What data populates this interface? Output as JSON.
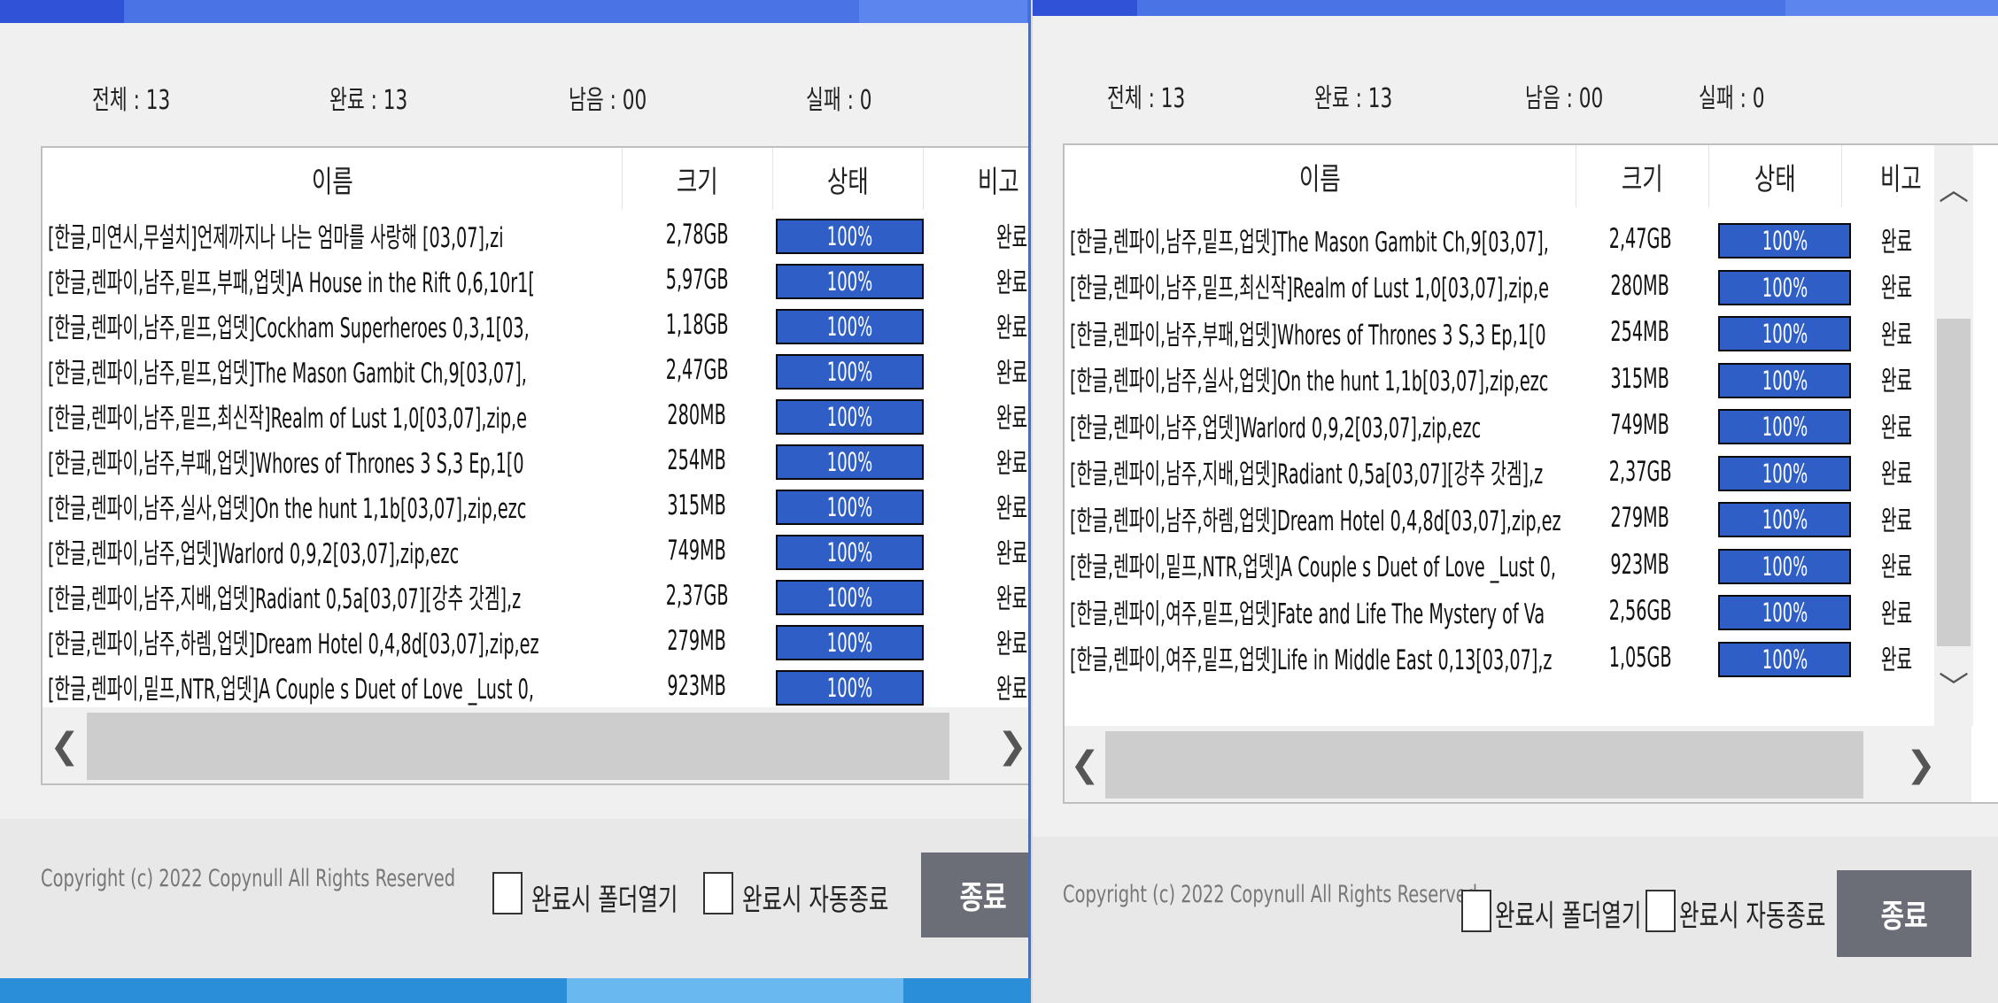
{
  "colors": {
    "titlebar": "#4a74e6",
    "progress": "#2f5fc6",
    "button": "#6b6e76"
  },
  "left": {
    "stats": {
      "total": "전체 : 13",
      "done": "완료 : 13",
      "remaining": "남음 : 00",
      "failed": "실패 : 0"
    },
    "columns": {
      "name": "이름",
      "size": "크기",
      "status": "상태",
      "note": "비고"
    },
    "rows": [
      {
        "name": "[한글,미연시,무설치]언제까지나 나는 엄마를 사랑해 [03,07],zi",
        "size": "2,78GB",
        "progress": 100,
        "progress_label": "100%",
        "note": "완료"
      },
      {
        "name": "[한글,렌파이,남주,밑프,부패,업뎃]A House in the Rift 0,6,10r1[",
        "size": "5,97GB",
        "progress": 100,
        "progress_label": "100%",
        "note": "완료"
      },
      {
        "name": "[한글,렌파이,남주,밑프,업뎃]Cockham Superheroes 0,3,1[03,",
        "size": "1,18GB",
        "progress": 100,
        "progress_label": "100%",
        "note": "완료"
      },
      {
        "name": "[한글,렌파이,남주,밑프,업뎃]The Mason Gambit Ch,9[03,07],",
        "size": "2,47GB",
        "progress": 100,
        "progress_label": "100%",
        "note": "완료"
      },
      {
        "name": "[한글,렌파이,남주,밑프,최신작]Realm of Lust 1,0[03,07],zip,e",
        "size": "280MB",
        "progress": 100,
        "progress_label": "100%",
        "note": "완료"
      },
      {
        "name": "[한글,렌파이,남주,부패,업뎃]Whores of Thrones 3 S,3 Ep,1[0",
        "size": "254MB",
        "progress": 100,
        "progress_label": "100%",
        "note": "완료"
      },
      {
        "name": "[한글,렌파이,남주,실사,업뎃]On the hunt 1,1b[03,07],zip,ezc",
        "size": "315MB",
        "progress": 100,
        "progress_label": "100%",
        "note": "완료"
      },
      {
        "name": "[한글,렌파이,남주,업뎃]Warlord 0,9,2[03,07],zip,ezc",
        "size": "749MB",
        "progress": 100,
        "progress_label": "100%",
        "note": "완료"
      },
      {
        "name": "[한글,렌파이,남주,지배,업뎃]Radiant 0,5a[03,07][강추 갓겜],z",
        "size": "2,37GB",
        "progress": 100,
        "progress_label": "100%",
        "note": "완료"
      },
      {
        "name": "[한글,렌파이,남주,하렘,업뎃]Dream Hotel 0,4,8d[03,07],zip,ez",
        "size": "279MB",
        "progress": 100,
        "progress_label": "100%",
        "note": "완료"
      },
      {
        "name": "[한글,렌파이,밑프,NTR,업뎃]A Couple s Duet of Love _Lust 0,",
        "size": "923MB",
        "progress": 100,
        "progress_label": "100%",
        "note": "완료"
      }
    ],
    "scroll": {
      "left": "❮",
      "right": "❯"
    },
    "footer": {
      "copyright": "Copyright (c) 2022 Copynull All Rights Reserved",
      "open_folder": "완료시 폴더열기",
      "auto_exit": "완료시 자동종료",
      "exit": "종료"
    }
  },
  "right": {
    "stats": {
      "total": "전체 : 13",
      "done": "완료 : 13",
      "remaining": "남음 : 00",
      "failed": "실패 : 0"
    },
    "columns": {
      "name": "이름",
      "size": "크기",
      "status": "상태",
      "note": "비고"
    },
    "rows": [
      {
        "name": "[한글,렌파이,남주,밑프,업뎃]The Mason Gambit Ch,9[03,07],",
        "size": "2,47GB",
        "progress": 100,
        "progress_label": "100%",
        "note": "완료"
      },
      {
        "name": "[한글,렌파이,남주,밑프,최신작]Realm of Lust 1,0[03,07],zip,e",
        "size": "280MB",
        "progress": 100,
        "progress_label": "100%",
        "note": "완료"
      },
      {
        "name": "[한글,렌파이,남주,부패,업뎃]Whores of Thrones 3 S,3 Ep,1[0",
        "size": "254MB",
        "progress": 100,
        "progress_label": "100%",
        "note": "완료"
      },
      {
        "name": "[한글,렌파이,남주,실사,업뎃]On the hunt 1,1b[03,07],zip,ezc",
        "size": "315MB",
        "progress": 100,
        "progress_label": "100%",
        "note": "완료"
      },
      {
        "name": "[한글,렌파이,남주,업뎃]Warlord 0,9,2[03,07],zip,ezc",
        "size": "749MB",
        "progress": 100,
        "progress_label": "100%",
        "note": "완료"
      },
      {
        "name": "[한글,렌파이,남주,지배,업뎃]Radiant 0,5a[03,07][강추 갓겜],z",
        "size": "2,37GB",
        "progress": 100,
        "progress_label": "100%",
        "note": "완료"
      },
      {
        "name": "[한글,렌파이,남주,하렘,업뎃]Dream Hotel 0,4,8d[03,07],zip,ez",
        "size": "279MB",
        "progress": 100,
        "progress_label": "100%",
        "note": "완료"
      },
      {
        "name": "[한글,렌파이,밑프,NTR,업뎃]A Couple s Duet of Love _Lust 0,",
        "size": "923MB",
        "progress": 100,
        "progress_label": "100%",
        "note": "완료"
      },
      {
        "name": "[한글,렌파이,여주,밑프,업뎃]Fate and Life The Mystery of Va",
        "size": "2,56GB",
        "progress": 100,
        "progress_label": "100%",
        "note": "완료"
      },
      {
        "name": "[한글,렌파이,여주,밑프,업뎃]Life in Middle East 0,13[03,07],z",
        "size": "1,05GB",
        "progress": 100,
        "progress_label": "100%",
        "note": "완료"
      }
    ],
    "scroll": {
      "left": "❮",
      "right": "❯",
      "up": "︿",
      "down": "﹀"
    },
    "footer": {
      "copyright": "Copyright (c) 2022 Copynull All Rights Reserved",
      "open_folder": "완료시 폴더열기",
      "auto_exit": "완료시 자동종료",
      "exit": "종료"
    }
  }
}
